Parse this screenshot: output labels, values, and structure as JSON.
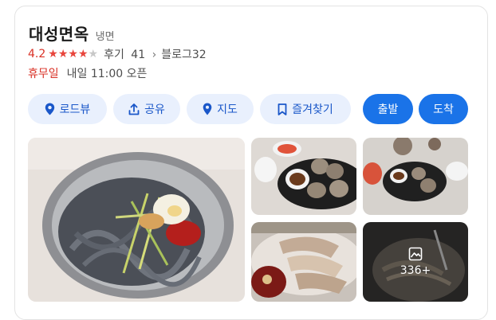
{
  "place": {
    "name": "대성면옥",
    "category": "냉면",
    "rating": "4.2",
    "stars_filled": 4,
    "stars_total": 5,
    "reviews_label": "후기",
    "reviews_count": "41",
    "blog_label": "블로그",
    "blog_count": "32",
    "status": "휴무일",
    "next_open": "내일 11:00 오픈"
  },
  "actions": {
    "roadview": "로드뷰",
    "share": "공유",
    "map": "지도",
    "favorite": "즐겨찾기",
    "depart": "출발",
    "arrive": "도착"
  },
  "photos": {
    "more_count": "336+",
    "items": [
      "naengmyeon-bowl",
      "dumplings-plate",
      "dumplings-table",
      "sliced-meat",
      "noodles-closeup"
    ]
  },
  "colors": {
    "accent": "#1a73e8",
    "accent_light": "#e9f0fd",
    "star": "#e8453c",
    "closed": "#d93025"
  }
}
